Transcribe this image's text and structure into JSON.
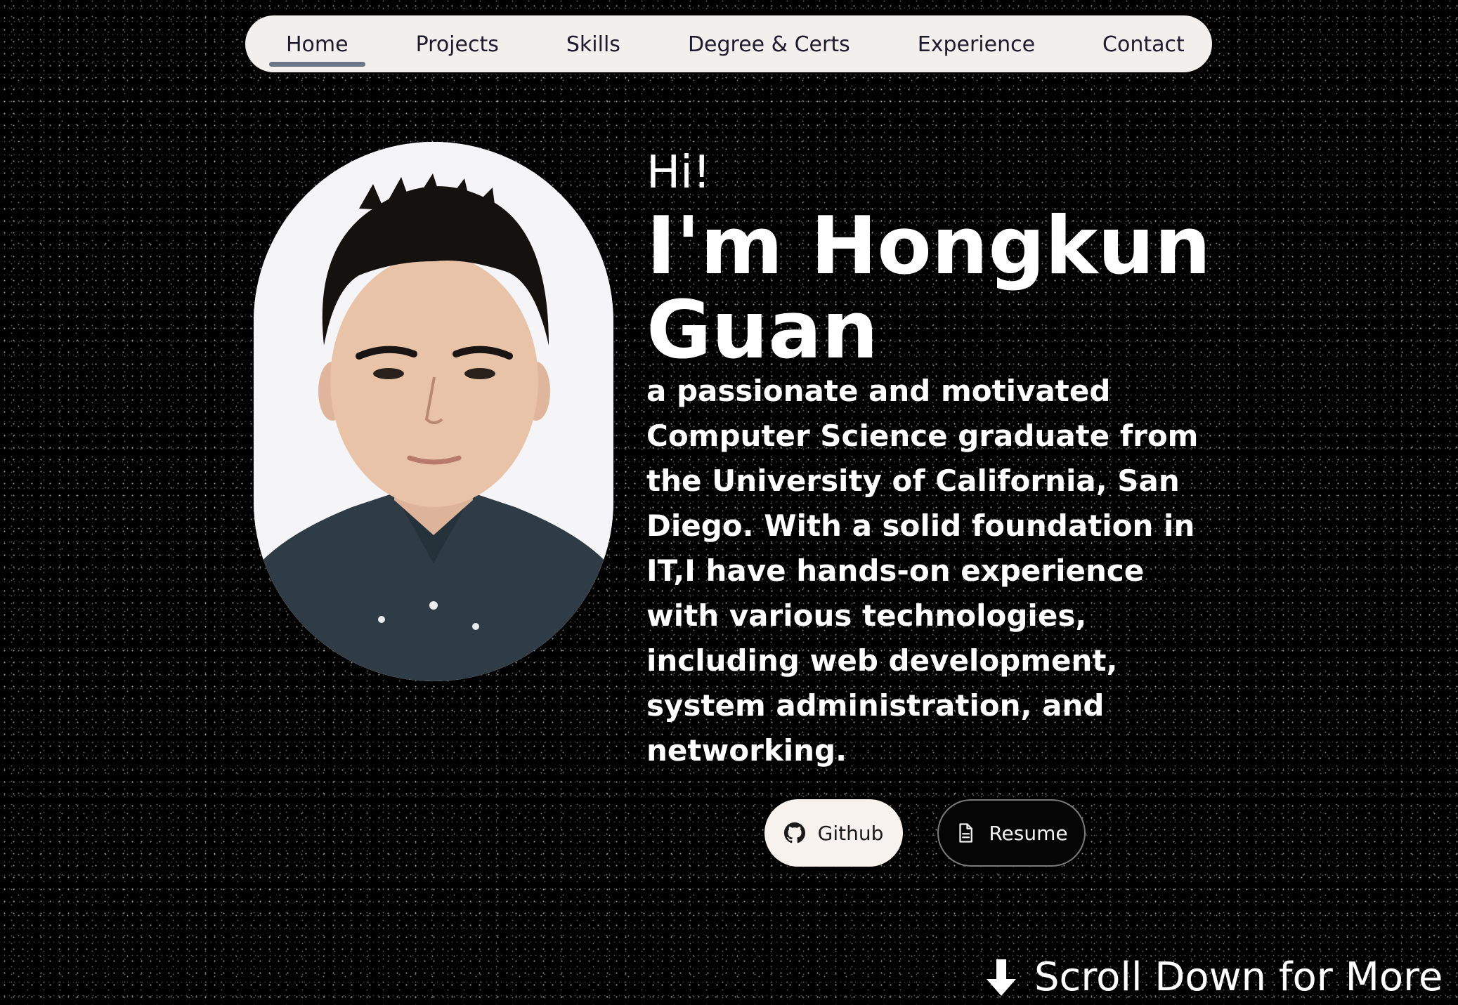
{
  "nav": {
    "items": [
      {
        "label": "Home",
        "active": true
      },
      {
        "label": "Projects",
        "active": false
      },
      {
        "label": "Skills",
        "active": false
      },
      {
        "label": "Degree & Certs",
        "active": false
      },
      {
        "label": "Experience",
        "active": false
      },
      {
        "label": "Contact",
        "active": false
      }
    ]
  },
  "hero": {
    "greeting": "Hi!",
    "name": "I'm Hongkun Guan",
    "bio": "a passionate and motivated Computer Science graduate from the University of California, San Diego. With a solid foundation in IT,I have hands-on experience with various technologies, including web development, system administration, and networking."
  },
  "buttons": {
    "github": {
      "label": "Github",
      "icon": "github-icon"
    },
    "resume": {
      "label": "Resume",
      "icon": "document-icon"
    }
  },
  "scroll_hint": {
    "label": "Scroll Down for More",
    "icon": "arrow-down-icon"
  },
  "colors": {
    "background": "#000000",
    "nav_background": "#f3efec",
    "nav_text": "#1d1b2e",
    "nav_active_underline": "#6b7688",
    "text": "#ffffff",
    "github_button_bg": "#f7f2ee",
    "resume_button_border": "#7a7a7a"
  }
}
